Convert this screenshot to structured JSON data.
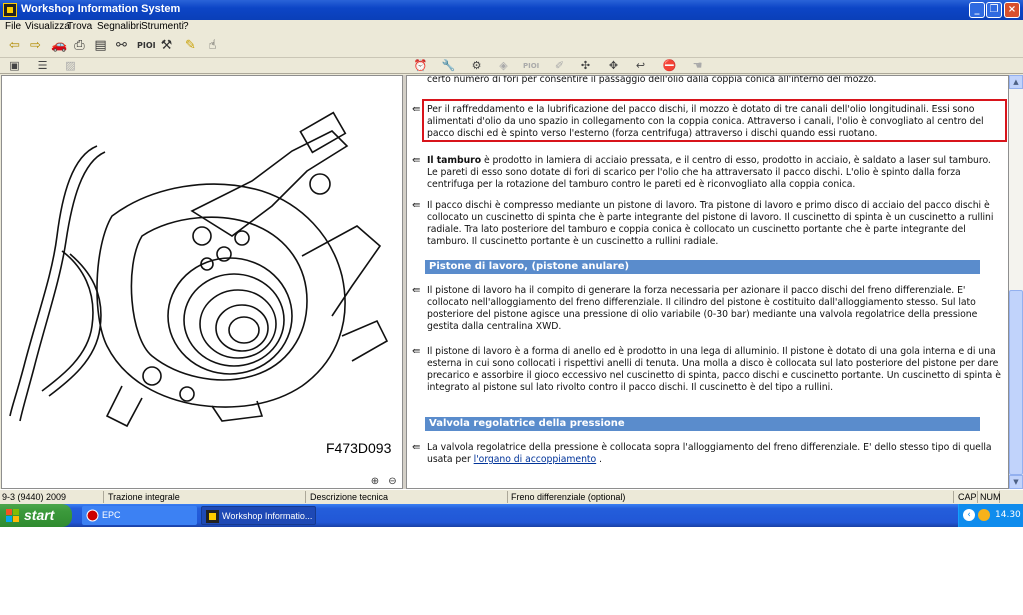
{
  "window": {
    "title": "Workshop Information System"
  },
  "menu": [
    "File",
    "Visualizza",
    "Trova",
    "Segnalibri",
    "Strumenti",
    "?"
  ],
  "toolbar": {
    "pioi_label": "PIOI"
  },
  "toolbar2": {
    "pioi_label": "PIOI"
  },
  "figure": {
    "label": "F473D093"
  },
  "content": {
    "p0": "certo numero di fori per consentire il passaggio dell'olio dalla coppia conica all'interno del mozzo.",
    "p1": "Per il raffreddamento e la lubrificazione del pacco dischi, il mozzo è dotato di tre canali dell'olio longitudinali. Essi sono alimentati d'olio da uno spazio in collegamento con la coppia conica. Attraverso i canali, l'olio è convogliato al centro del pacco dischi ed è spinto verso l'esterno (forza centrifuga) attraverso i dischi quando essi ruotano.",
    "p2_bold": "Il tamburo",
    "p2_rest": " è prodotto in lamiera di acciaio pressata, e il centro di esso, prodotto in acciaio, è saldato a laser sul tamburo. Le pareti di esso sono dotate di fori di scarico per l'olio che ha attraversato il pacco dischi. L'olio è spinto dalla forza centrifuga per la rotazione del tamburo contro le pareti ed è riconvogliato alla coppia conica.",
    "p3": "Il pacco dischi è compresso mediante un pistone di lavoro. Tra pistone di lavoro e primo disco di acciaio del pacco dischi è collocato un cuscinetto di spinta che è parte integrante del pistone di lavoro. Il cuscinetto di spinta è un cuscinetto a rullini radiale. Tra lato posteriore del tamburo e coppia conica è collocato un cuscinetto portante che è parte integrante del tamburo. Il cuscinetto portante è un cuscinetto a rullini radiale.",
    "section1": "Pistone di lavoro, (pistone anulare)",
    "p4": "Il pistone di lavoro ha il compito di generare la forza necessaria per azionare il pacco dischi del freno differenziale. E' collocato nell'alloggiamento del freno differenziale. Il cilindro del pistone è costituito dall'alloggiamento stesso. Sul lato posteriore del pistone agisce una pressione di olio variabile (0-30 bar) mediante una valvola regolatrice della pressione gestita dalla centralina XWD.",
    "p5": "Il pistone di lavoro è a forma di anello ed è prodotto in una lega di alluminio. Il pistone è dotato di una gola interna e di una esterna in cui sono collocati i rispettivi anelli di tenuta. Una molla a disco è collocata sul lato posteriore del pistone per dare precarico e assorbire il gioco eccessivo nel cuscinetto di spinta, pacco dischi e cuscinetto portante. Un cuscinetto di spinta è integrato al pistone sul lato rivolto contro il pacco dischi. Il cuscinetto è del tipo a rullini.",
    "section2": "Valvola regolatrice della pressione",
    "p6_pre": "La valvola regolatrice della pressione è collocata sopra l'alloggiamento del freno differenziale. E' dello stesso tipo di quella usata per ",
    "p6_link": "l'organo di accoppiamento",
    "p6_post": " ."
  },
  "status": {
    "model": "9-3 (9440) 2009",
    "drive": "Trazione integrale",
    "doc_type": "Descrizione tecnica",
    "component": "Freno differenziale (optional)",
    "cap": "CAP",
    "num": "NUM"
  },
  "taskbar": {
    "start": "start",
    "tasks": [
      "EPC",
      "Workshop Informatio..."
    ],
    "clock": "14.30"
  },
  "colors": {
    "highlight_border": "#d8141b",
    "section_bg": "#5a8ccc",
    "taskbar": "#245edb"
  }
}
